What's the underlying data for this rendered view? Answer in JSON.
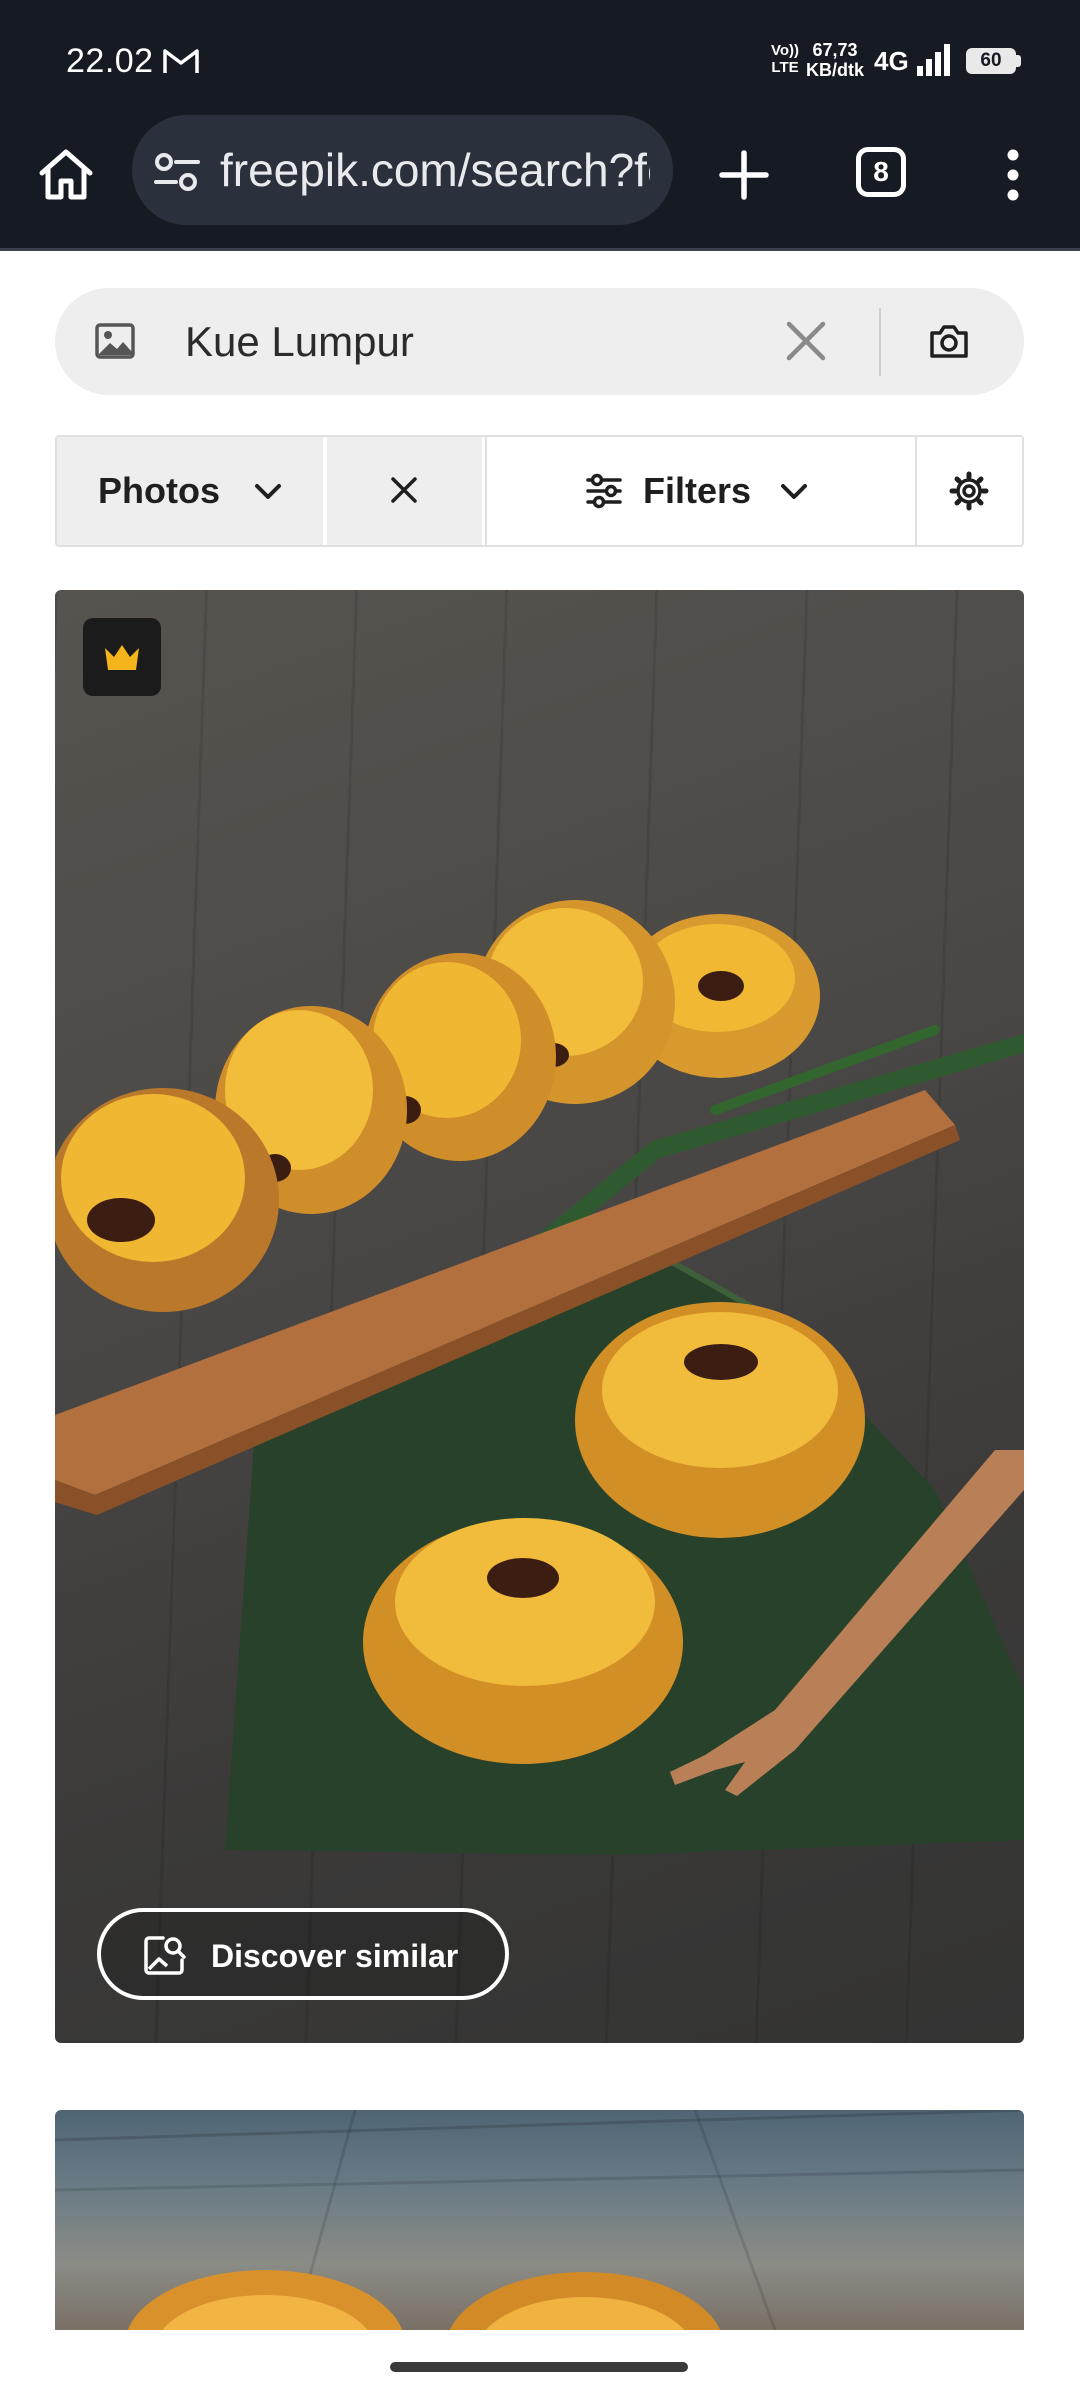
{
  "status_bar": {
    "time": "22.02",
    "volte": "Vo)) LTE",
    "speed_value": "67,73",
    "speed_unit": "KB/dtk",
    "network": "4G",
    "battery": "60",
    "icons": [
      "gmail-icon",
      "signal-icon",
      "battery-icon"
    ]
  },
  "browser": {
    "url": "freepik.com/search?fc",
    "tab_count": "8",
    "icons": [
      "home-icon",
      "site-settings-icon",
      "new-tab-icon",
      "tabs-icon",
      "more-menu-icon"
    ]
  },
  "search": {
    "query": "Kue Lumpur",
    "icons": [
      "image-search-icon",
      "clear-icon",
      "camera-icon"
    ]
  },
  "filters": {
    "type_label": "Photos",
    "filters_label": "Filters",
    "icons": [
      "chevron-down-icon",
      "close-icon",
      "sliders-icon",
      "gear-icon"
    ]
  },
  "results": [
    {
      "premium": true,
      "discover_label": "Discover similar"
    },
    {
      "premium": false
    }
  ],
  "colors": {
    "browser_bar": "#161a22",
    "url_box": "#2b313c",
    "premium_crown": "#f3b51b",
    "search_bg": "#eeeeee"
  }
}
